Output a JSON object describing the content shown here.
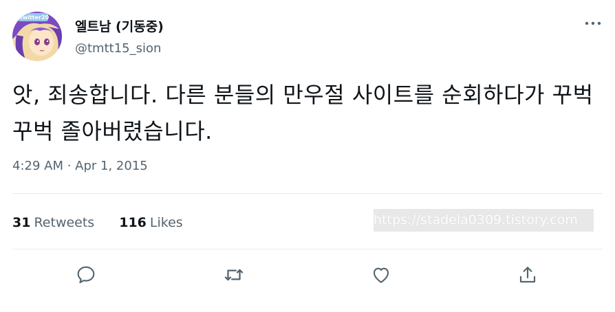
{
  "author": {
    "display_name": "엘트남 (기동중)",
    "handle": "@tmtt15_sion",
    "avatar_badge": "twitter20"
  },
  "tweet": {
    "text": "앗, 죄송합니다. 다른 분들의 만우절 사이트를 순회하다가 꾸벅꾸벅 졸아버렸습니다.",
    "timestamp": "4:29 AM · Apr 1, 2015"
  },
  "stats": {
    "retweets_count": "31",
    "retweets_label": "Retweets",
    "likes_count": "116",
    "likes_label": "Likes"
  },
  "watermark": "https://stadela0309.tistory.com",
  "icons": {
    "more": "more-icon",
    "reply": "reply-icon",
    "retweet": "retweet-icon",
    "like": "heart-icon",
    "share": "share-icon"
  },
  "colors": {
    "primary_text": "#0f1419",
    "secondary_text": "#536471",
    "divider": "#e6ecf0"
  }
}
